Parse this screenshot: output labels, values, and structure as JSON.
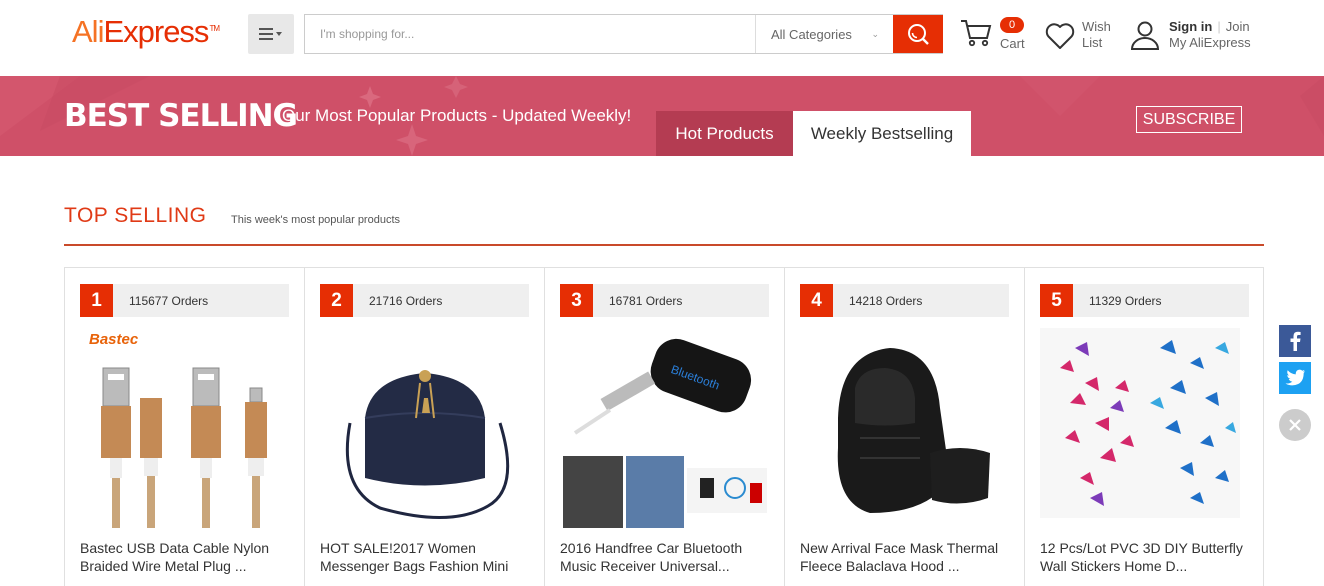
{
  "header": {
    "logo_ali": "Ali",
    "logo_express": "Express",
    "logo_tm": "TM",
    "search_placeholder": "I'm shopping for...",
    "category": "All Categories",
    "cart_count": "0",
    "cart_label": "Cart",
    "wish_line1": "Wish",
    "wish_line2": "List",
    "signin": "Sign in",
    "join": "Join",
    "my_account": "My AliExpress"
  },
  "banner": {
    "title": "BEST SELLING",
    "subtitle": "Our Most Popular Products - Updated Weekly!",
    "tab_hot": "Hot Products",
    "tab_weekly": "Weekly Bestselling",
    "subscribe": "SUBSCRIBE"
  },
  "section": {
    "title": "TOP SELLING",
    "subtitle": "This week's most popular products"
  },
  "products": [
    {
      "rank": "1",
      "orders": "115677 Orders",
      "brand": "Bastec",
      "title": "Bastec USB Data Cable Nylon Braided Wire Metal Plug ..."
    },
    {
      "rank": "2",
      "orders": "21716 Orders",
      "title": "HOT SALE!2017 Women Messenger Bags Fashion Mini"
    },
    {
      "rank": "3",
      "orders": "16781 Orders",
      "label": "Bluetooth",
      "title": "2016 Handfree Car Bluetooth Music Receiver Universal..."
    },
    {
      "rank": "4",
      "orders": "14218 Orders",
      "title": "New Arrival Face Mask Thermal Fleece Balaclava Hood ..."
    },
    {
      "rank": "5",
      "orders": "11329 Orders",
      "title": "12 Pcs/Lot PVC 3D DIY Butterfly Wall Stickers Home D..."
    }
  ],
  "colors": {
    "accent": "#e62e04",
    "banner": "#cf5068",
    "tab_active": "#b43c52",
    "facebook": "#3b5998",
    "twitter": "#1da1f2"
  },
  "icons": [
    "menu-icon",
    "search-icon",
    "cart-icon",
    "heart-icon",
    "user-icon",
    "facebook-icon",
    "twitter-icon",
    "close-icon"
  ]
}
